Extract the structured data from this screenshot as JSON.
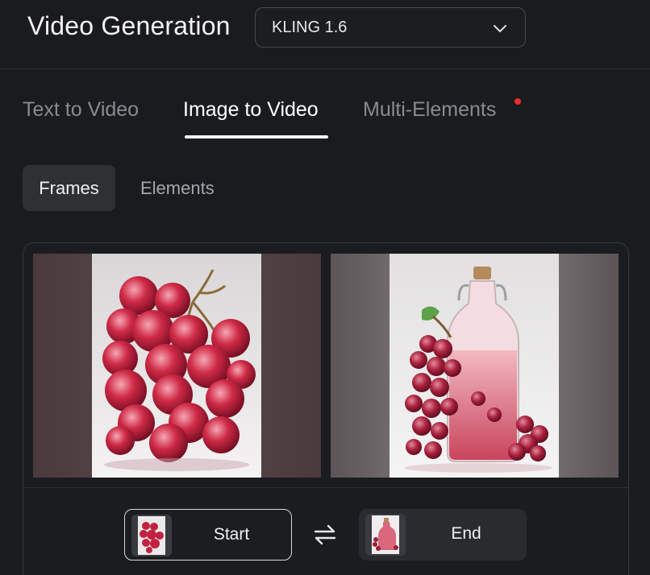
{
  "header": {
    "title": "Video Generation",
    "model": "KLING 1.6"
  },
  "tabs": [
    {
      "label": "Text to Video",
      "active": false
    },
    {
      "label": "Image to Video",
      "active": true
    },
    {
      "label": "Multi-Elements",
      "active": false,
      "has_notification": true
    }
  ],
  "subtabs": [
    {
      "label": "Frames",
      "active": true
    },
    {
      "label": "Elements",
      "active": false
    }
  ],
  "frames": {
    "start": {
      "image": "red grapes with water droplets"
    },
    "end": {
      "image": "glass bottle with pink drink and red grapes"
    }
  },
  "slots": {
    "start_label": "Start",
    "end_label": "End",
    "swap_icon": "swap-arrows-icon"
  },
  "colors": {
    "background": "#1a1b1e",
    "accent_dot": "#ee2b2b",
    "active_text": "#ffffff",
    "inactive_text": "#8a8b90"
  }
}
